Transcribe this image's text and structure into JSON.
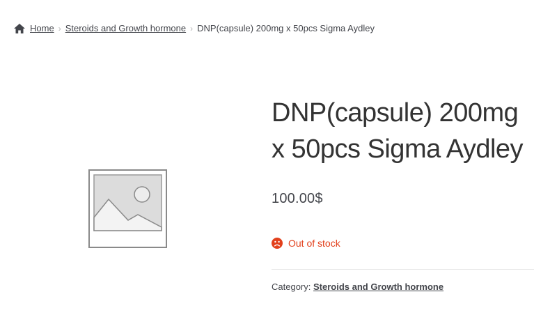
{
  "breadcrumb": {
    "home": "Home",
    "category": "Steroids and Growth hormone",
    "current": "DNP(capsule) 200mg x 50pcs Sigma Aydley",
    "separator": "›"
  },
  "product": {
    "title": "DNP(capsule) 200mg x 50pcs Sigma Aydley",
    "price": "100.00$",
    "stock_status": "Out of stock",
    "category_label": "Category:",
    "category_value": "Steroids and Growth hormone"
  },
  "colors": {
    "out_of_stock": "#e2401c",
    "text": "#43454b"
  },
  "icons": [
    "home-icon",
    "placeholder-image-icon",
    "frown-icon"
  ]
}
